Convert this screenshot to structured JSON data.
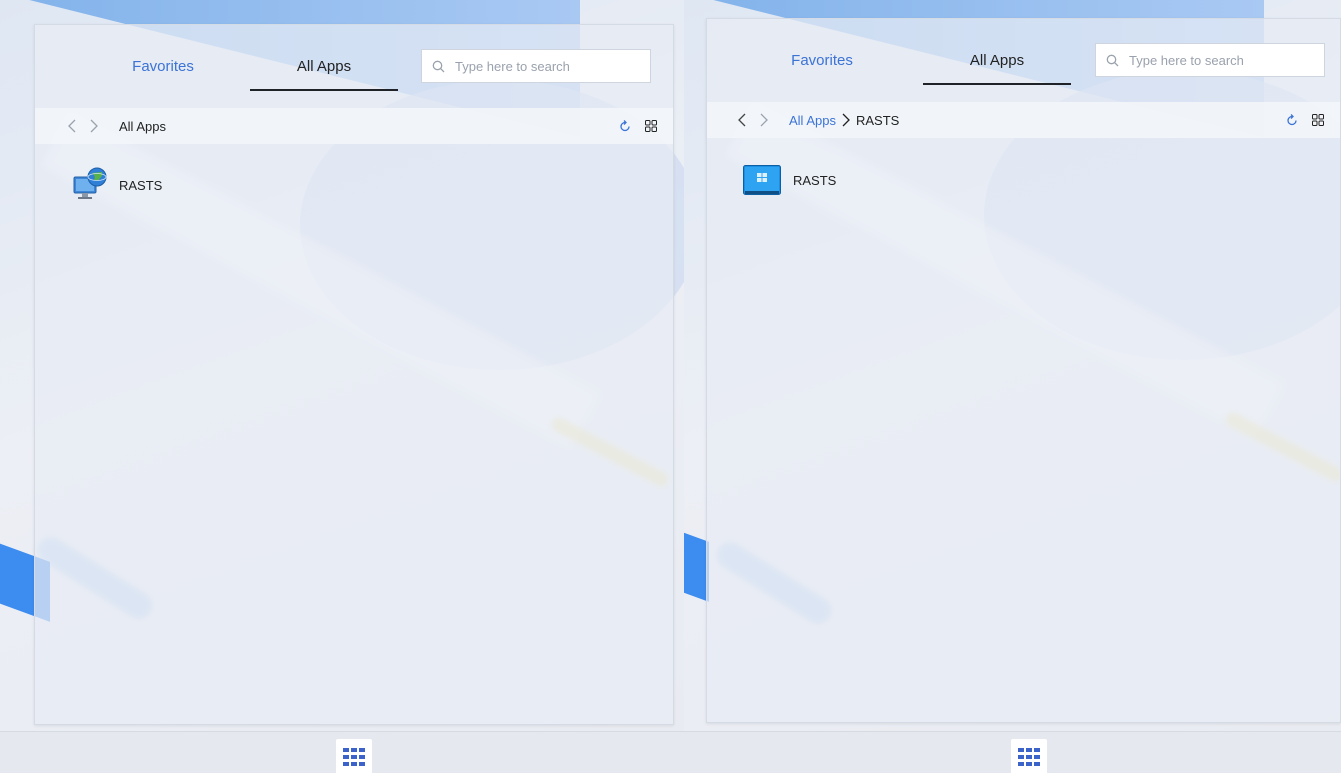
{
  "left": {
    "tabs": {
      "favorites": "Favorites",
      "all_apps": "All Apps"
    },
    "search": {
      "placeholder": "Type here to search"
    },
    "breadcrumb": {
      "current": "All Apps"
    },
    "apps": [
      {
        "label": "RASTS",
        "icon": "globe-monitor-icon"
      }
    ]
  },
  "right": {
    "tabs": {
      "favorites": "Favorites",
      "all_apps": "All Apps"
    },
    "search": {
      "placeholder": "Type here to search"
    },
    "breadcrumb": {
      "parent": "All Apps",
      "current": "RASTS"
    },
    "apps": [
      {
        "label": "RASTS",
        "icon": "windows-desktop-icon"
      }
    ]
  },
  "colors": {
    "accent": "#3b73d6",
    "active_underline": "#1f2328"
  }
}
